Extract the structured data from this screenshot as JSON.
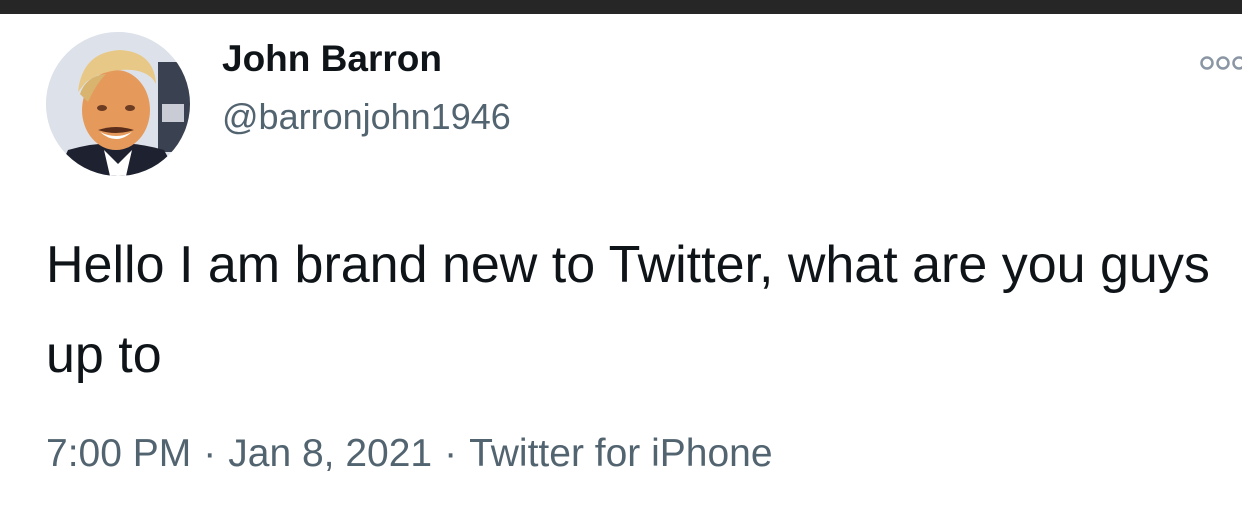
{
  "tweet": {
    "author": {
      "display_name": "John Barron",
      "handle": "@barronjohn1946",
      "avatar_icon": "profile-photo"
    },
    "more_icon": "more-options-icon",
    "text": "Hello I am brand new to Twitter, what are you guys up to",
    "time": "7:00 PM",
    "date": "Jan 8, 2021",
    "separator": "·",
    "source": "Twitter for iPhone"
  },
  "colors": {
    "top_bar": "#262626",
    "text_primary": "#0f1419",
    "text_secondary": "#536471",
    "background": "#ffffff"
  }
}
